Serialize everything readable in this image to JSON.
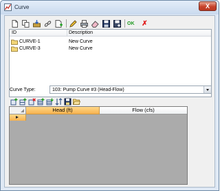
{
  "window": {
    "title": "Curve",
    "close_glyph": "X"
  },
  "toolbar": {
    "icons": [
      "new-icon",
      "copy-icon",
      "import-icon",
      "link-icon",
      "add-icon",
      "edit-icon",
      "print-icon",
      "eraser-icon",
      "save-icon",
      "save-as-icon",
      "ok-icon",
      "cancel-icon"
    ],
    "ok_label": "OK",
    "cancel_glyph": "✗"
  },
  "curve_list": {
    "columns": [
      "ID",
      "Description"
    ],
    "rows": [
      {
        "id": "CURVE-1",
        "description": "New Curve"
      },
      {
        "id": "CURVE-3",
        "description": "New Curve"
      }
    ]
  },
  "curve_type": {
    "label": "Curve Type:",
    "selected": "103: Pump Curve #3 (Head-Flow)"
  },
  "grid_toolbar": {
    "icons": [
      "insert-row-icon",
      "append-row-icon",
      "delete-row-icon",
      "copy-rows-icon",
      "paste-rows-icon",
      "sort-icon",
      "save-icon",
      "open-icon"
    ]
  },
  "grid": {
    "columns": [
      "Head (ft)",
      "Flow (cfs)"
    ]
  },
  "colors": {
    "selected_header": "#f7b24f",
    "ok_green": "#1e9a1e",
    "cancel_red": "#e01818"
  }
}
